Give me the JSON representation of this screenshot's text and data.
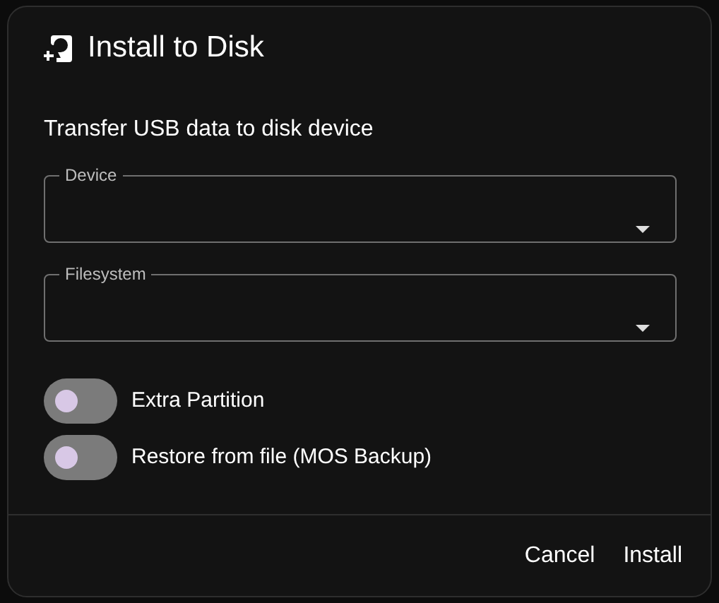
{
  "dialog": {
    "title": "Install to Disk",
    "subtitle": "Transfer USB data to disk device",
    "fields": [
      {
        "label": "Device"
      },
      {
        "label": "Filesystem"
      }
    ],
    "toggles": [
      {
        "label": "Extra Partition",
        "on": false
      },
      {
        "label": "Restore from file (MOS Backup)",
        "on": false
      }
    ],
    "buttons": [
      "Cancel",
      "Install"
    ]
  }
}
